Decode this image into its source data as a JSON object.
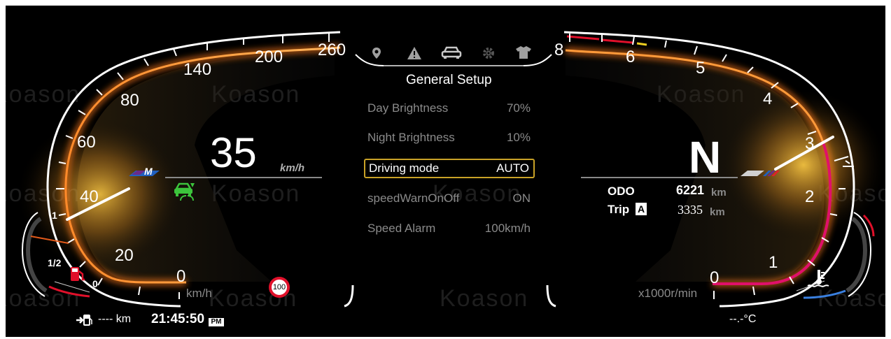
{
  "colors": {
    "background": "#000000",
    "gauge_glow": "#ff7a1a",
    "tach_accent": "#e0106a",
    "selection": "#c9a227",
    "eco_icon": "#3cc43c",
    "text_dim": "#8a8a8a"
  },
  "watermark": "Koason",
  "speedometer": {
    "speed": "35",
    "unit_label": "km/h",
    "scale_unit": "km/h",
    "ticks": [
      "0",
      "20",
      "40",
      "60",
      "80",
      "140",
      "200",
      "260"
    ],
    "needle_value": 40,
    "speed_limit_sign": "100",
    "m_badge": "M",
    "eco_icon": "eco-drive-icon"
  },
  "fuel": {
    "labels": [
      "1",
      "1/2",
      "0"
    ],
    "icon": "fuel-pump-icon"
  },
  "menu": {
    "tabs": [
      {
        "icon": "location-pin-icon"
      },
      {
        "icon": "warning-icon"
      },
      {
        "icon": "car-icon",
        "selected": true
      },
      {
        "icon": "gear-icon"
      },
      {
        "icon": "shirt-icon"
      }
    ],
    "title": "General Setup",
    "items": [
      {
        "label": "Day Brightness",
        "value": "70%"
      },
      {
        "label": "Night Brightness",
        "value": "10%"
      },
      {
        "label": "Driving mode",
        "value": "AUTO",
        "selected": true
      },
      {
        "label": "speedWarnOnOff",
        "value": "ON"
      },
      {
        "label": "Speed Alarm",
        "value": "100km/h"
      }
    ]
  },
  "tachometer": {
    "gear": "N",
    "ticks": [
      "0",
      "1",
      "2",
      "3",
      "4",
      "5",
      "6",
      "8"
    ],
    "unit": "x1000r/min",
    "needle_value": 3
  },
  "trip": {
    "odo_label": "ODO",
    "odo_value": "6221",
    "odo_unit": "km",
    "trip_label": "Trip",
    "trip_badge": "A",
    "trip_value": "3335",
    "trip_unit": "km"
  },
  "coolant": {
    "icon": "coolant-temp-icon"
  },
  "status": {
    "range_icon": "fuel-range-icon",
    "range": "---- km",
    "time": "21:45:50",
    "ampm": "PM",
    "temperature": "--.-°C"
  }
}
